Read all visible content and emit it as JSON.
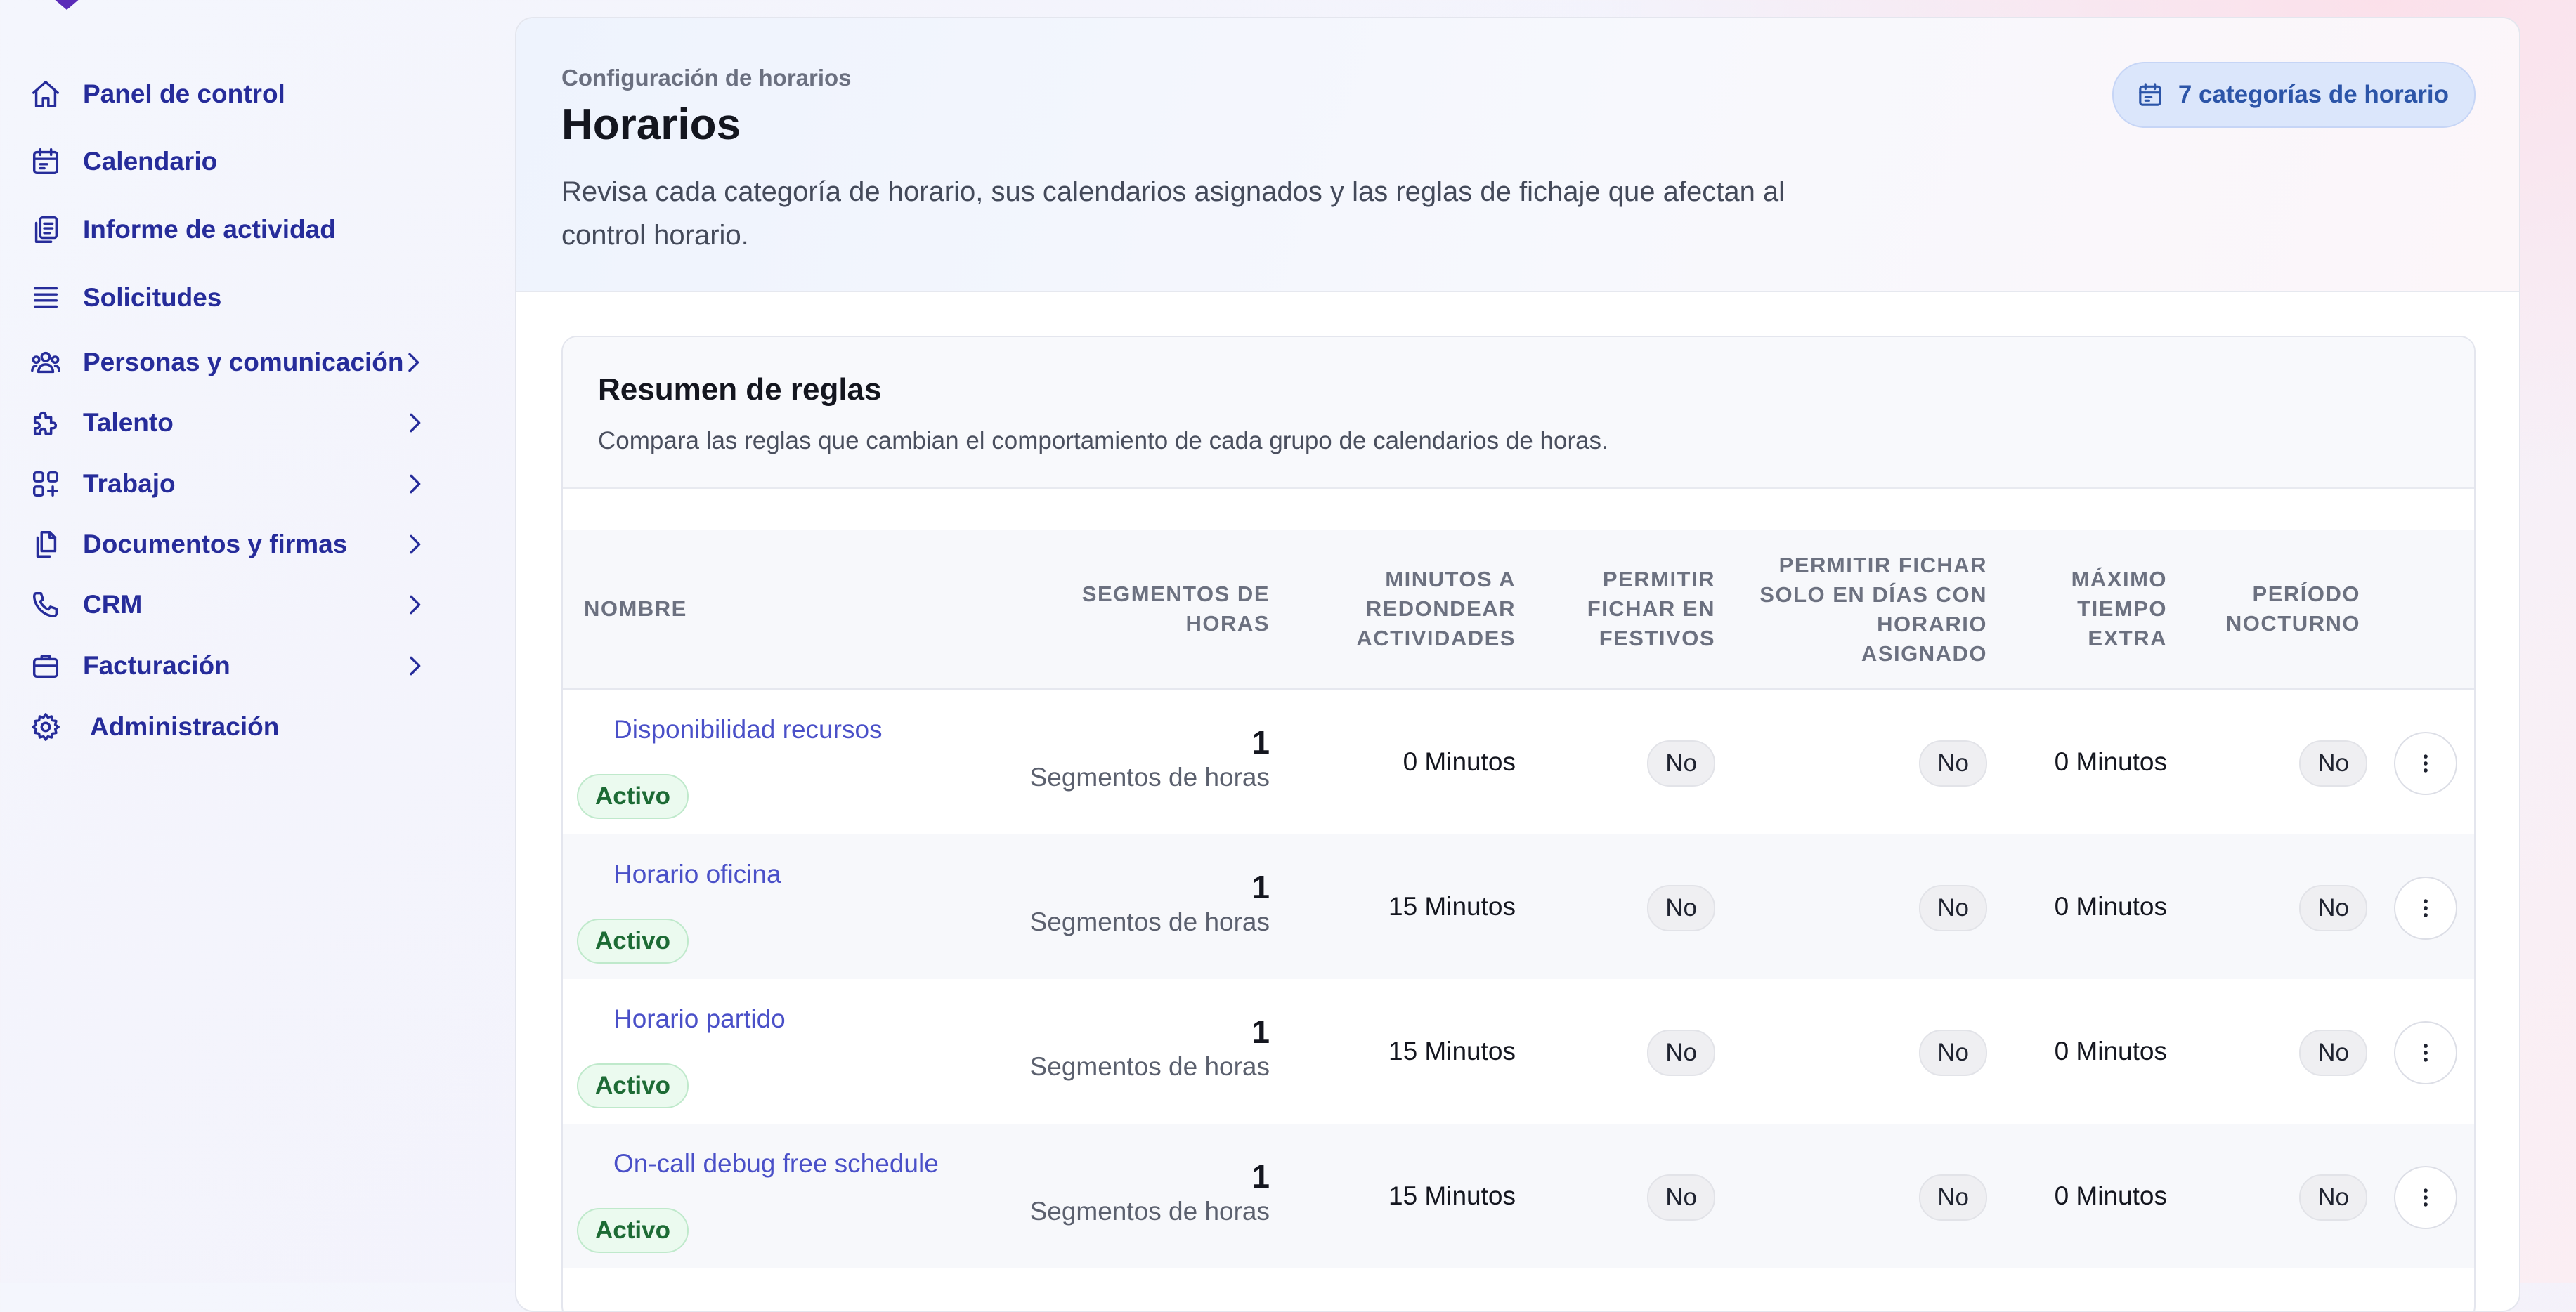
{
  "sidebar": {
    "items": [
      {
        "label": "Panel de control",
        "icon": "home-icon",
        "has_submenu": false
      },
      {
        "label": "Calendario",
        "icon": "calendar-icon",
        "has_submenu": false
      },
      {
        "label": "Informe de actividad",
        "icon": "clipboard-icon",
        "has_submenu": false
      },
      {
        "label": "Solicitudes",
        "icon": "list-icon",
        "has_submenu": false
      },
      {
        "label": "Personas y comunicación",
        "icon": "users-icon",
        "has_submenu": true
      },
      {
        "label": "Talento",
        "icon": "puzzle-icon",
        "has_submenu": true
      },
      {
        "label": "Trabajo",
        "icon": "grid-plus-icon",
        "has_submenu": true
      },
      {
        "label": "Documentos y firmas",
        "icon": "documents-icon",
        "has_submenu": true
      },
      {
        "label": "CRM",
        "icon": "phone-icon",
        "has_submenu": true
      },
      {
        "label": "Facturación",
        "icon": "briefcase-icon",
        "has_submenu": true
      },
      {
        "label": "Administración",
        "icon": "gear-icon",
        "has_submenu": false
      }
    ]
  },
  "header": {
    "eyebrow": "Configuración de horarios",
    "title": "Horarios",
    "description": "Revisa cada categoría de horario, sus calendarios asignados y las reglas de fichaje que afectan al control horario.",
    "badge": "7 categorías de horario"
  },
  "card": {
    "title": "Resumen de reglas",
    "description": "Compara las reglas que cambian el comportamiento de cada grupo de calendarios de horas."
  },
  "table": {
    "columns": [
      "NOMBRE",
      "SEGMENTOS DE HORAS",
      "MINUTOS A REDONDEAR ACTIVIDADES",
      "PERMITIR FICHAR EN FESTIVOS",
      "PERMITIR FICHAR SOLO EN DÍAS CON HORARIO ASIGNADO",
      "MÁXIMO TIEMPO EXTRA",
      "PERÍODO NOCTURNO"
    ],
    "rows": [
      {
        "name": "Disponibilidad recursos",
        "status": "Activo",
        "segments": "1",
        "segments_label": "Segmentos de horas",
        "rounding": "0 Minutos",
        "holidays": "No",
        "assigned_only": "No",
        "max_overtime": "0 Minutos",
        "night": "No"
      },
      {
        "name": "Horario oficina",
        "status": "Activo",
        "segments": "1",
        "segments_label": "Segmentos de horas",
        "rounding": "15 Minutos",
        "holidays": "No",
        "assigned_only": "No",
        "max_overtime": "0 Minutos",
        "night": "No"
      },
      {
        "name": "Horario partido",
        "status": "Activo",
        "segments": "1",
        "segments_label": "Segmentos de horas",
        "rounding": "15 Minutos",
        "holidays": "No",
        "assigned_only": "No",
        "max_overtime": "0 Minutos",
        "night": "No"
      },
      {
        "name": "On-call debug free schedule",
        "status": "Activo",
        "segments": "1",
        "segments_label": "Segmentos de horas",
        "rounding": "15 Minutos",
        "holidays": "No",
        "assigned_only": "No",
        "max_overtime": "0 Minutos",
        "night": "No"
      }
    ]
  },
  "colors": {
    "nav_text": "#262c9a",
    "link": "#4a50c8",
    "status_bg": "#ebfaef",
    "status_text": "#1d6b35",
    "badge_bg": "#dbe6fb",
    "badge_text": "#2c55a8"
  }
}
